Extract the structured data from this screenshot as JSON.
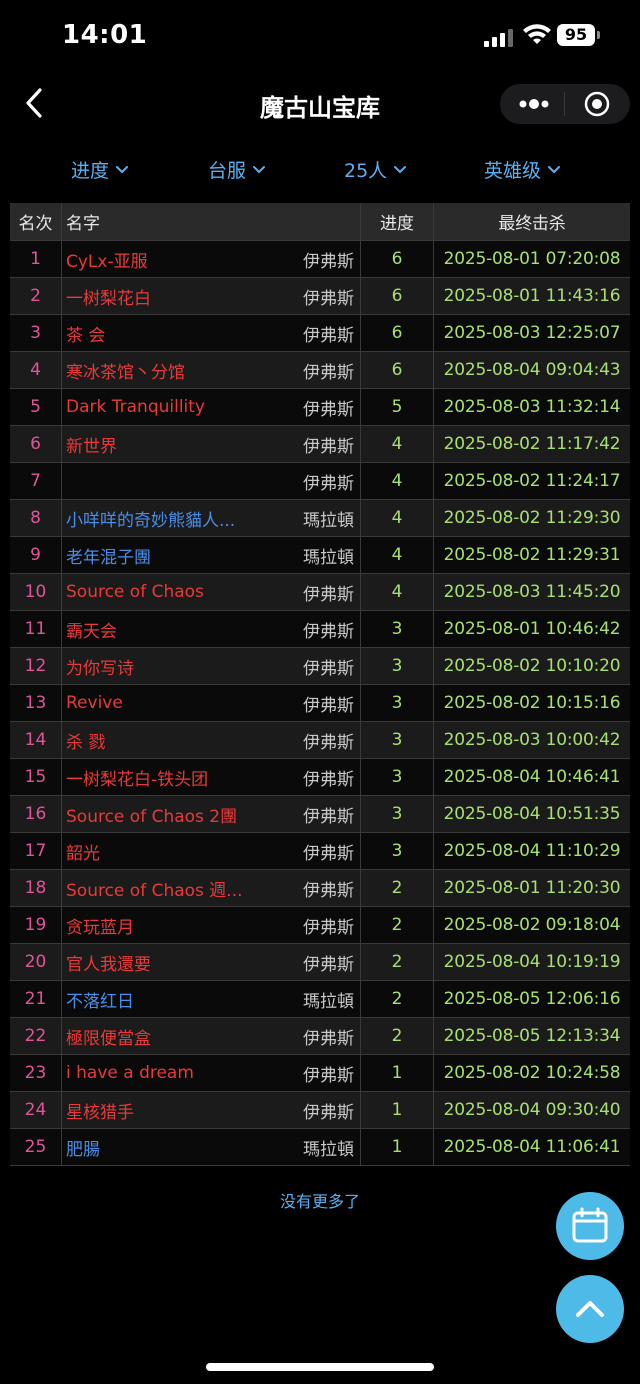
{
  "status_bar": {
    "time": "14:01",
    "battery": "95"
  },
  "nav": {
    "title": "魔古山宝库"
  },
  "filters": [
    {
      "label": "进度"
    },
    {
      "label": "台服"
    },
    {
      "label": "25人"
    },
    {
      "label": "英雄级"
    }
  ],
  "table": {
    "headers": {
      "rank": "名次",
      "name": "名字",
      "progress": "进度",
      "last_kill": "最终击杀"
    },
    "rows": [
      {
        "rank": "1",
        "name": "CyLx-亚服",
        "faction": "horde",
        "realm": "伊弗斯",
        "progress": "6",
        "last_kill": "2025-08-01 07:20:08"
      },
      {
        "rank": "2",
        "name": "一树梨花白",
        "faction": "horde",
        "realm": "伊弗斯",
        "progress": "6",
        "last_kill": "2025-08-01 11:43:16"
      },
      {
        "rank": "3",
        "name": "茶 会",
        "faction": "horde",
        "realm": "伊弗斯",
        "progress": "6",
        "last_kill": "2025-08-03 12:25:07"
      },
      {
        "rank": "4",
        "name": "寒冰茶馆丶分馆",
        "faction": "horde",
        "realm": "伊弗斯",
        "progress": "6",
        "last_kill": "2025-08-04 09:04:43"
      },
      {
        "rank": "5",
        "name": "Dark Tranquillity",
        "faction": "horde",
        "realm": "伊弗斯",
        "progress": "5",
        "last_kill": "2025-08-03 11:32:14"
      },
      {
        "rank": "6",
        "name": "新世界",
        "faction": "horde",
        "realm": "伊弗斯",
        "progress": "4",
        "last_kill": "2025-08-02 11:17:42"
      },
      {
        "rank": "7",
        "name": "",
        "faction": "horde",
        "realm": "伊弗斯",
        "progress": "4",
        "last_kill": "2025-08-02 11:24:17"
      },
      {
        "rank": "8",
        "name": "小咩咩的奇妙熊貓人...",
        "faction": "alliance",
        "realm": "瑪拉頓",
        "progress": "4",
        "last_kill": "2025-08-02 11:29:30"
      },
      {
        "rank": "9",
        "name": "老年混子團",
        "faction": "alliance",
        "realm": "瑪拉頓",
        "progress": "4",
        "last_kill": "2025-08-02 11:29:31"
      },
      {
        "rank": "10",
        "name": "Source of Chaos",
        "faction": "horde",
        "realm": "伊弗斯",
        "progress": "4",
        "last_kill": "2025-08-03 11:45:20"
      },
      {
        "rank": "11",
        "name": "霸天会",
        "faction": "horde",
        "realm": "伊弗斯",
        "progress": "3",
        "last_kill": "2025-08-01 10:46:42"
      },
      {
        "rank": "12",
        "name": "为你写诗",
        "faction": "horde",
        "realm": "伊弗斯",
        "progress": "3",
        "last_kill": "2025-08-02 10:10:20"
      },
      {
        "rank": "13",
        "name": "Revive",
        "faction": "horde",
        "realm": "伊弗斯",
        "progress": "3",
        "last_kill": "2025-08-02 10:15:16"
      },
      {
        "rank": "14",
        "name": "杀 戮",
        "faction": "horde",
        "realm": "伊弗斯",
        "progress": "3",
        "last_kill": "2025-08-03 10:00:42"
      },
      {
        "rank": "15",
        "name": "一树梨花白-铁头团",
        "faction": "horde",
        "realm": "伊弗斯",
        "progress": "3",
        "last_kill": "2025-08-04 10:46:41"
      },
      {
        "rank": "16",
        "name": "Source of Chaos 2團",
        "faction": "horde",
        "realm": "伊弗斯",
        "progress": "3",
        "last_kill": "2025-08-04 10:51:35"
      },
      {
        "rank": "17",
        "name": "韶光",
        "faction": "horde",
        "realm": "伊弗斯",
        "progress": "3",
        "last_kill": "2025-08-04 11:10:29"
      },
      {
        "rank": "18",
        "name": "Source of Chaos 週...",
        "faction": "horde",
        "realm": "伊弗斯",
        "progress": "2",
        "last_kill": "2025-08-01 11:20:30"
      },
      {
        "rank": "19",
        "name": "贪玩蓝月",
        "faction": "horde",
        "realm": "伊弗斯",
        "progress": "2",
        "last_kill": "2025-08-02 09:18:04"
      },
      {
        "rank": "20",
        "name": "官人我還要",
        "faction": "horde",
        "realm": "伊弗斯",
        "progress": "2",
        "last_kill": "2025-08-04 10:19:19"
      },
      {
        "rank": "21",
        "name": "不落红日",
        "faction": "alliance",
        "realm": "瑪拉頓",
        "progress": "2",
        "last_kill": "2025-08-05 12:06:16"
      },
      {
        "rank": "22",
        "name": "極限便當盒",
        "faction": "horde",
        "realm": "伊弗斯",
        "progress": "2",
        "last_kill": "2025-08-05 12:13:34"
      },
      {
        "rank": "23",
        "name": "i have a dream",
        "faction": "horde",
        "realm": "伊弗斯",
        "progress": "1",
        "last_kill": "2025-08-02 10:24:58"
      },
      {
        "rank": "24",
        "name": "星核猎手",
        "faction": "horde",
        "realm": "伊弗斯",
        "progress": "1",
        "last_kill": "2025-08-04 09:30:40"
      },
      {
        "rank": "25",
        "name": "肥腸",
        "faction": "alliance",
        "realm": "瑪拉頓",
        "progress": "1",
        "last_kill": "2025-08-04 11:06:41"
      }
    ]
  },
  "footer": {
    "no_more": "没有更多了"
  },
  "colors": {
    "horde": "#e83a3a",
    "alliance": "#4a8ee8",
    "accent": "#5ab0f0",
    "fab": "#4ebae8",
    "progress": "#a8e070",
    "rank": "#e0559a"
  },
  "icons": {
    "back": "chevron-left-icon",
    "more": "more-dots-icon",
    "target": "target-icon",
    "calendar": "calendar-icon",
    "scroll_top": "chevron-up-icon"
  }
}
